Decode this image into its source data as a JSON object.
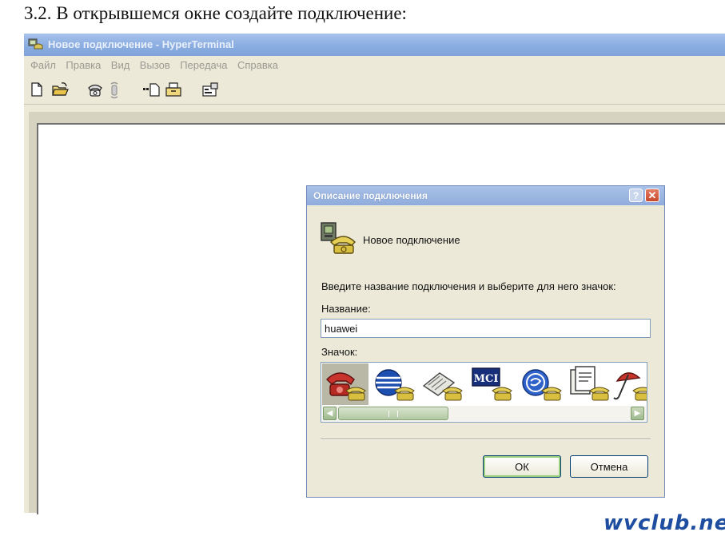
{
  "caption": "3.2. В открывшемся окне создайте подключение:",
  "window": {
    "title": "Новое подключение - HyperTerminal",
    "menu": [
      "Файл",
      "Правка",
      "Вид",
      "Вызов",
      "Передача",
      "Справка"
    ],
    "toolbar_icons": [
      "new-file-icon",
      "open-folder-icon",
      "phone-icon",
      "disconnect-icon",
      "send-icon",
      "receive-icon",
      "properties-icon"
    ]
  },
  "dialog": {
    "title": "Описание подключения",
    "help_label": "?",
    "close_label": "✕",
    "connection_name": "Новое подключение",
    "prompt": "Введите название подключения и выберите для него значок:",
    "name_label": "Название:",
    "name_value": "huawei",
    "icon_label": "Значок:",
    "icon_options": [
      "red-phone-icon",
      "globe-phone-icon",
      "fax-phone-icon",
      "mci-phone-icon",
      "ge-phone-icon",
      "clipboard-phone-icon",
      "umbrella-phone-icon"
    ],
    "selected_icon_index": 0,
    "scroll_grip": "III",
    "ok_label": "ОК",
    "cancel_label": "Отмена"
  },
  "watermark": "wvclub.net",
  "colors": {
    "title_bar": "#8fb0e2",
    "dialog_title_bar": "#90acdc",
    "window_face": "#ece9d8",
    "watermark": "#1f4ea0"
  }
}
